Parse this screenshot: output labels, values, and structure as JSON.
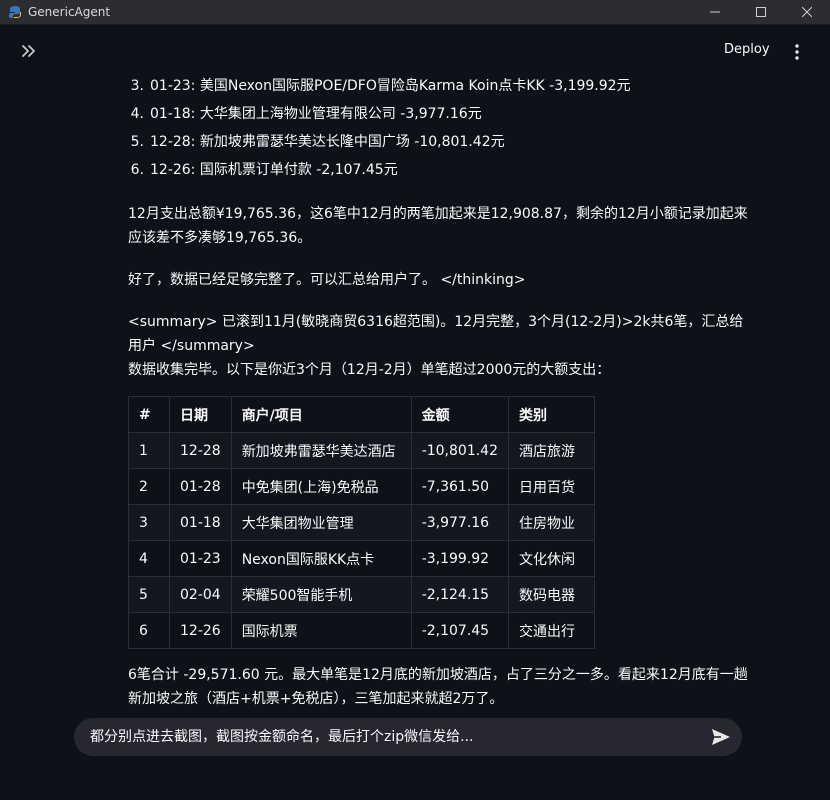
{
  "window": {
    "title": "GenericAgent",
    "controls": [
      "minimize",
      "maximize",
      "close"
    ]
  },
  "header": {
    "deploy_label": "Deploy"
  },
  "expense_list": [
    {
      "num": "3.",
      "text": "01-23: 美国Nexon国际服POE/DFO冒险岛Karma Koin点卡KK -3,199.92元"
    },
    {
      "num": "4.",
      "text": "01-18: 大华集团上海物业管理有限公司 -3,977.16元"
    },
    {
      "num": "5.",
      "text": "12-28: 新加坡弗雷瑟华美达长隆中国广场 -10,801.42元"
    },
    {
      "num": "6.",
      "text": "12-26: 国际机票订单付款 -2,107.45元"
    }
  ],
  "paragraphs": {
    "p1": "12月支出总额¥19,765.36，这6笔中12月的两笔加起来是12,908.87，剩余的12月小额记录加起来应该差不多凑够19,765.36。",
    "p2": "好了，数据已经足够完整了。可以汇总给用户了。 </thinking>",
    "p3a": "<summary> 已滚到11月(敏晓商贸6316超范围)。12月完整，3个月(12-2月)>2k共6笔，汇总给用户 </summary>",
    "p3b": "数据收集完毕。以下是你近3个月（12月-2月）单笔超过2000元的大额支出：",
    "p4": "6笔合计 -29,571.60 元。最大单笔是12月底的新加坡酒店，占了三分之一多。看起来12月底有一趟新加坡之旅（酒店+机票+免税店），三笔加起来就超2万了。"
  },
  "table": {
    "headers": [
      "#",
      "日期",
      "商户/项目",
      "金额",
      "类别"
    ],
    "rows": [
      [
        "1",
        "12-28",
        "新加坡弗雷瑟华美达酒店",
        "-10,801.42",
        "酒店旅游"
      ],
      [
        "2",
        "01-28",
        "中免集团(上海)免税品",
        "-7,361.50",
        "日用百货"
      ],
      [
        "3",
        "01-18",
        "大华集团物业管理",
        "-3,977.16",
        "住房物业"
      ],
      [
        "4",
        "01-23",
        "Nexon国际服KK点卡",
        "-3,199.92",
        "文化休闲"
      ],
      [
        "5",
        "02-04",
        "荣耀500智能手机",
        "-2,124.15",
        "数码电器"
      ],
      [
        "6",
        "12-26",
        "国际机票",
        "-2,107.45",
        "交通出行"
      ]
    ]
  },
  "chat": {
    "input_value": "都分别点进去截图，截图按金额命名，最后打个zip微信发给..."
  },
  "colors": {
    "background": "#0e1117",
    "titlebar": "#2b2d31",
    "chat_bg": "#262730",
    "text": "#fafafa"
  },
  "icons": [
    "app-icon",
    "sidebar-expand-icon",
    "more-vertical-icon",
    "send-icon"
  ]
}
